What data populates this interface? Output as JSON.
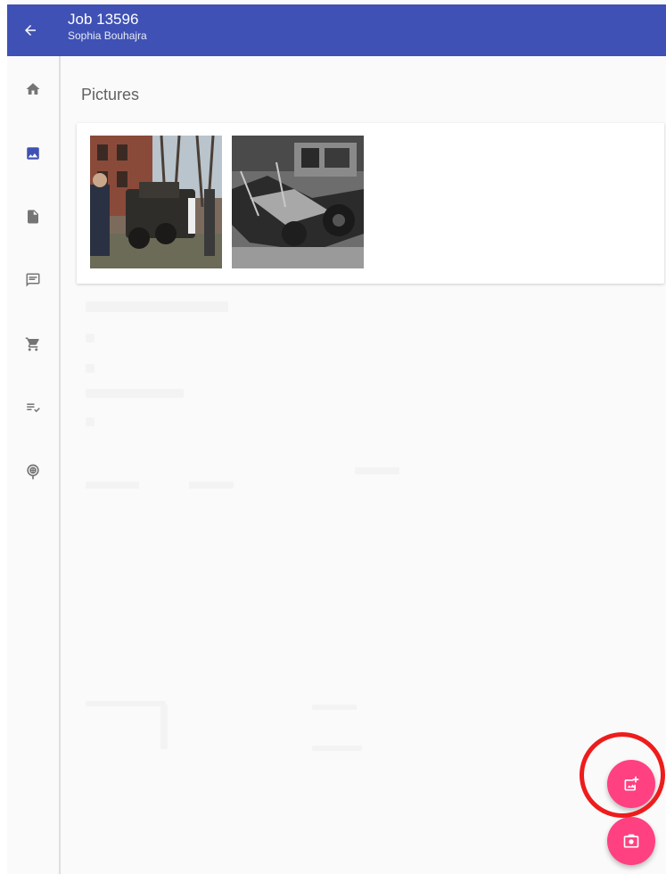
{
  "header": {
    "title": "Job 13596",
    "subtitle": "Sophia Bouhajra",
    "back_icon": "arrow-back-icon"
  },
  "nav_rail": {
    "items": [
      {
        "name": "home",
        "icon": "home-icon",
        "active": false
      },
      {
        "name": "pictures",
        "icon": "image-icon",
        "active": true
      },
      {
        "name": "documents",
        "icon": "document-icon",
        "active": false
      },
      {
        "name": "messages",
        "icon": "message-icon",
        "active": false
      },
      {
        "name": "cart",
        "icon": "cart-icon",
        "active": false
      },
      {
        "name": "checklist",
        "icon": "checklist-icon",
        "active": false
      },
      {
        "name": "location",
        "icon": "location-icon",
        "active": false
      }
    ]
  },
  "main": {
    "section_title": "Pictures",
    "pictures": [
      {
        "name": "street-car-photo"
      },
      {
        "name": "wrecked-car-photo"
      }
    ]
  },
  "fabs": [
    {
      "name": "add-photo",
      "icon": "add-photo-icon",
      "highlighted": true
    },
    {
      "name": "camera",
      "icon": "camera-icon",
      "highlighted": false
    }
  ],
  "colors": {
    "primary": "#3f51b5",
    "accent": "#ff4081",
    "highlight_ring": "#ee1c1c",
    "icon_inactive": "#757575"
  }
}
